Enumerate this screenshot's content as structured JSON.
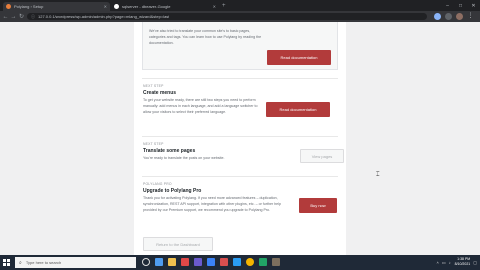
{
  "browser": {
    "tabs": [
      {
        "title": "Polylang › Setup",
        "favicon_color": "#e87e3c"
      },
      {
        "title": "sqlserver - dbeaver-Google",
        "favicon_color": "#ffffff"
      }
    ],
    "new_tab": "+",
    "url": "127.0.0.1/wordpress/wp-admin/admin.php?page=mlang_wizard&step=last",
    "window_controls": {
      "minimize": "–",
      "maximize": "□",
      "close": "✕"
    }
  },
  "wizard": {
    "top_card": {
      "desc": "We've also tried to translate your common site's to basic pages, categories and tags. You can learn how to use Polylang by reading the documentation.",
      "button": "Read documentation"
    },
    "create_menus": {
      "step": "NEXT STEP",
      "heading": "Create menus",
      "desc": "To get your website ready, there are still two steps you need to perform manually: add menus in each language, and add a language switcher to allow your visitors to select their preferred language.",
      "button": "Read documentation"
    },
    "translate_pages": {
      "step": "NEXT STEP",
      "heading": "Translate some pages",
      "desc": "You're ready to translate the posts on your website.",
      "button": "View pages"
    },
    "upgrade": {
      "step": "POLYLANG PRO",
      "heading": "Upgrade to Polylang Pro",
      "desc": "Thank you for activating Polylang. If you need more advanced features – duplication, synchronization, REST API support, integration with other plugins, etc. – or further help provided by our Premium support, we recommend you upgrade to Polylang Pro.",
      "button": "Buy now"
    },
    "return_button": "Return to the Dashboard"
  },
  "taskbar": {
    "search_placeholder": "Type here to search",
    "time": "1:38 PM",
    "date": "8/10/2021"
  },
  "colors": {
    "accent": "#b23b3b",
    "taskbar": "#1f2937"
  }
}
